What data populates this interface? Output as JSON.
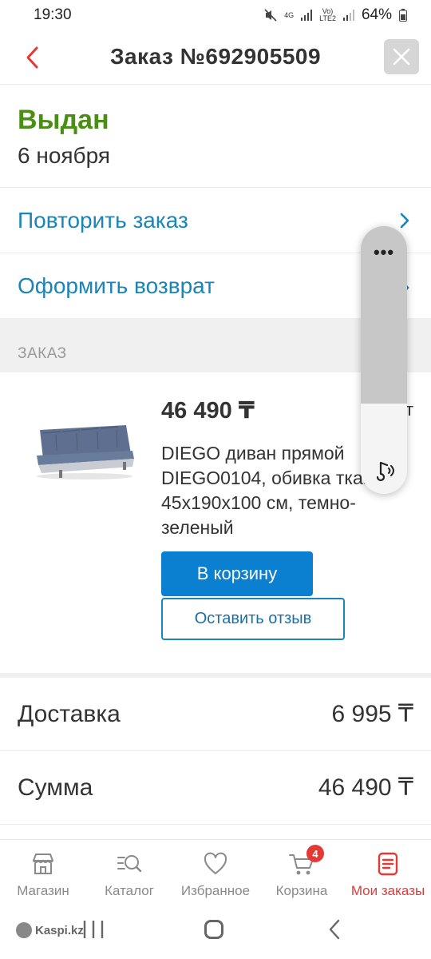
{
  "status_bar": {
    "time": "19:30",
    "net1": "4G",
    "net2_a": "Vo)",
    "net2_b": "LTE2",
    "battery": "64%"
  },
  "header": {
    "title": "Заказ №692905509"
  },
  "order_status": {
    "title": "Выдан",
    "date": "6 ноября"
  },
  "actions": [
    {
      "label": "Повторить заказ"
    },
    {
      "label": "Оформить возврат"
    }
  ],
  "section": {
    "title": "ЗАКАЗ"
  },
  "product": {
    "price": "46 490 ₸",
    "name": "DIEGO диван прямой DIEGO0104, обивка ткань, 45x190x100 см, темно-зеленый",
    "cart_button": "В корзину",
    "review_button": "Оставить отзыв"
  },
  "summary": [
    {
      "label": "Доставка",
      "value": "6 995 ₸"
    },
    {
      "label": "Сумма",
      "value": "46 490 ₸"
    }
  ],
  "floating_widget": {
    "dots": "•••",
    "peek_char": "т"
  },
  "bottom_nav": {
    "items": [
      {
        "label": "Магазин",
        "icon": "store-icon"
      },
      {
        "label": "Каталог",
        "icon": "catalog-search-icon"
      },
      {
        "label": "Избранное",
        "icon": "heart-icon"
      },
      {
        "label": "Корзина",
        "icon": "cart-icon",
        "badge": "4"
      },
      {
        "label": "Мои заказы",
        "icon": "orders-icon",
        "active": true
      }
    ]
  },
  "system_nav": {
    "app_tag": "Kaspi.kz"
  },
  "colors": {
    "accent_blue": "#0b7fd0",
    "link_blue": "#1a85b8",
    "status_green": "#4a8f13",
    "active_red": "#e53935"
  }
}
